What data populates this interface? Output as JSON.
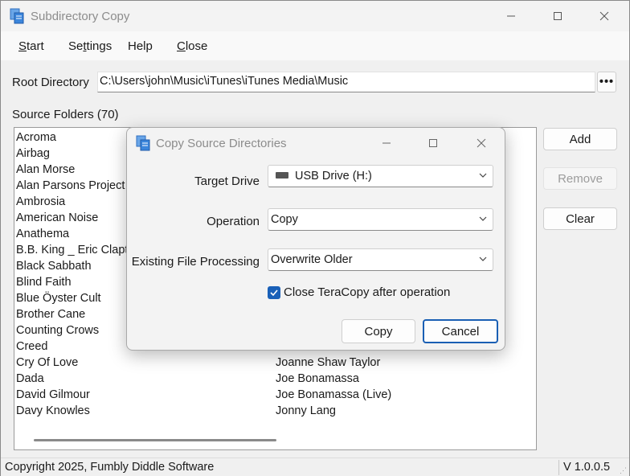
{
  "window": {
    "title": "Subdirectory Copy",
    "icon": "copy-app-icon"
  },
  "menu": {
    "items": [
      {
        "label": "Start",
        "mnemonic": "S"
      },
      {
        "label": "Settings",
        "mnemonic": "t"
      },
      {
        "label": "Help",
        "mnemonic": ""
      },
      {
        "label": "Close",
        "mnemonic": "C"
      }
    ]
  },
  "root": {
    "label": "Root Directory",
    "value": "C:\\Users\\john\\Music\\iTunes\\iTunes Media\\Music",
    "browse_label": "•••"
  },
  "source": {
    "label": "Source Folders (70)",
    "col1": [
      "Acroma",
      "Airbag",
      "Alan Morse",
      "Alan Parsons Project",
      "Ambrosia",
      "American Noise",
      "Anathema",
      "B.B. King _ Eric Clapton",
      "Black Sabbath",
      "Blind Faith",
      "Blue Öyster Cult",
      "Brother Cane",
      "Counting Crows",
      "Creed",
      "Cry Of Love",
      "Dada",
      "David Gilmour",
      "Davy Knowles"
    ],
    "col2": [
      "Joanne Shaw Taylor",
      "Joe Bonamassa",
      "Joe Bonamassa (Live)",
      "Jonny Lang"
    ]
  },
  "buttons": {
    "add": "Add",
    "remove": "Remove",
    "clear": "Clear"
  },
  "status": {
    "copyright": "Copyright 2025, Fumbly Diddle Software",
    "version": "V 1.0.0.5"
  },
  "dialog": {
    "title": "Copy Source Directories",
    "target_drive_label": "Target Drive",
    "target_drive_value": "USB Drive (H:)",
    "operation_label": "Operation",
    "operation_value": "Copy",
    "existing_label": "Existing File Processing",
    "existing_value": "Overwrite Older",
    "close_teracopy_label": "Close TeraCopy after operation",
    "close_teracopy_checked": true,
    "copy_button": "Copy",
    "cancel_button": "Cancel"
  },
  "colors": {
    "accent": "#1960b8",
    "title_text": "#8c8c8c"
  }
}
